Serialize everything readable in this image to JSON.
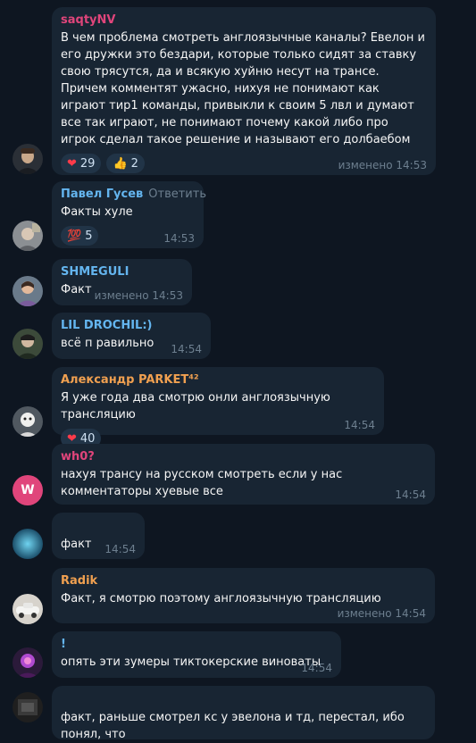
{
  "messages": [
    {
      "author": "saqtyNV",
      "author_color": "#e0457b",
      "text": "В чем проблема смотреть англоязычные каналы? Евелон и его дружки это бездари, которые только сидят за ставку свою трясутся, да и всякую хуйню несут на трансе. Причем комментят ужасно, нихуя не понимают как играют тир1 команды, привыкли к своим 5 лвл и думают все так играют, не понимают почему какой либо про игрок сделал такое решение и называют его долбаебом",
      "time": "изменено 14:53",
      "reactions": [
        {
          "icon": "heart-icon",
          "glyph": "❤",
          "count": "29"
        },
        {
          "icon": "thumbs-up-icon",
          "glyph": "👍",
          "count": "2"
        }
      ]
    },
    {
      "author": "Павел Гусев",
      "author_color": "#64b5ef",
      "reply_label": "Ответить",
      "text": "Факты хуле",
      "time": "14:53",
      "reactions": [
        {
          "icon": "hundred-icon",
          "glyph": "💯",
          "count": "5"
        }
      ]
    },
    {
      "author": "SHMEGULI",
      "author_color": "#64b5ef",
      "text": "Факт",
      "time": "изменено 14:53"
    },
    {
      "author": "LIL DROCHIL:)",
      "author_color": "#64b5ef",
      "text": "всё п равильно",
      "time": "14:54"
    },
    {
      "author": "Александр PARKET⁴²",
      "author_color": "#f0a050",
      "text": "Я уже года два смотрю онли англоязычную трансляцию",
      "time": "14:54",
      "reactions": [
        {
          "icon": "heart-icon",
          "glyph": "❤",
          "count": "40"
        }
      ]
    },
    {
      "author": "wh0?",
      "author_color": "#e0457b",
      "avatar_letter": "W",
      "text": "нахуя трансу на русском смотреть если у нас комментаторы хуевые все",
      "time": "14:54"
    },
    {
      "text": "факт",
      "time": "14:54"
    },
    {
      "author": "Radik",
      "author_color": "#f0a050",
      "text": "Факт, я смотрю поэтому англоязычную трансляцию",
      "time": "изменено 14:54"
    },
    {
      "author": "!",
      "author_color": "#64b5ef",
      "text": "опять эти зумеры тиктокерские виноваты",
      "time": "14:54"
    },
    {
      "text": "факт, раньше смотрел кс у эвелона и тд, перестал, ибо понял, что"
    }
  ]
}
